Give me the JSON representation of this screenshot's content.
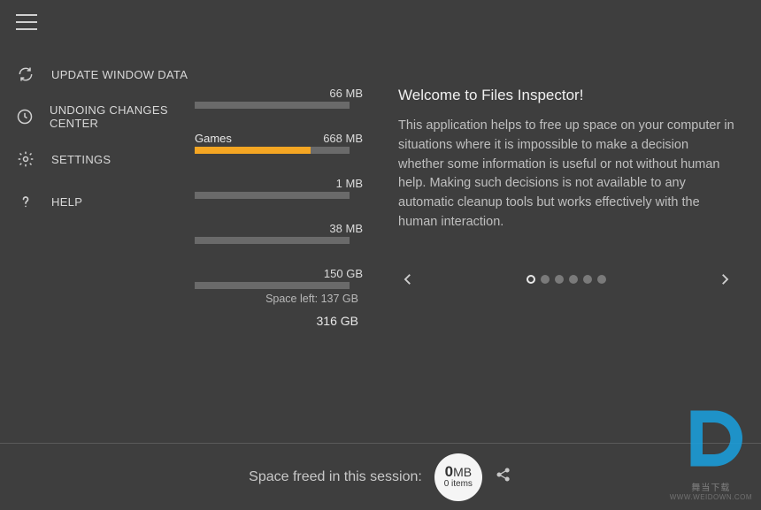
{
  "sidebar": {
    "items": [
      {
        "label": "UPDATE WINDOW DATA",
        "icon": "refresh-icon"
      },
      {
        "label": "UNDOING CHANGES CENTER",
        "icon": "undo-icon"
      },
      {
        "label": "SETTINGS",
        "icon": "gear-icon"
      },
      {
        "label": "HELP",
        "icon": "help-icon"
      }
    ]
  },
  "storage": {
    "rows": [
      {
        "label": "",
        "size": "66 MB",
        "fill_pct": 0
      },
      {
        "label": "Games",
        "size": "668 MB",
        "fill_pct": 75
      },
      {
        "label": "",
        "size": "1 MB",
        "fill_pct": 0
      },
      {
        "label": "",
        "size": "38 MB",
        "fill_pct": 0
      },
      {
        "label": "",
        "size": "150 GB",
        "fill_pct": 0
      }
    ],
    "space_left": "Space left: 137 GB",
    "total": "316 GB"
  },
  "welcome": {
    "title": "Welcome to Files Inspector!",
    "body": "This application helps to free up space on your computer in situations where it is impossible to make a decision whether some information is useful or not without human help. Making such decisions is not available to any automatic cleanup tools but works effectively with the human interaction.",
    "page_count": 6,
    "active_page": 0
  },
  "footer": {
    "label": "Space freed in this session:",
    "value": "0",
    "unit": "MB",
    "items": "0 items"
  },
  "watermark": {
    "text": "舞当下载",
    "url": "WWW.WEIDOWN.COM"
  }
}
